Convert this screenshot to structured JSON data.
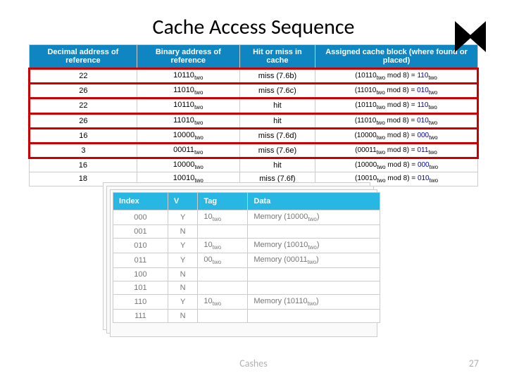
{
  "title": "Cache Access Sequence",
  "footer": {
    "left": "Cashes",
    "right": "27"
  },
  "table1": {
    "headers": [
      "Decimal address of reference",
      "Binary address of reference",
      "Hit or miss in cache",
      "Assigned cache block (where found or placed)"
    ],
    "rows": [
      {
        "dec": "22",
        "bin": "10110",
        "hm": "miss (7.6b)",
        "assign_in": "10110",
        "assign_out": "110",
        "hl": true
      },
      {
        "dec": "26",
        "bin": "11010",
        "hm": "miss (7.6c)",
        "assign_in": "11010",
        "assign_out": "010",
        "hl": true
      },
      {
        "dec": "22",
        "bin": "10110",
        "hm": "hit",
        "assign_in": "10110",
        "assign_out": "110",
        "hl": true
      },
      {
        "dec": "26",
        "bin": "11010",
        "hm": "hit",
        "assign_in": "11010",
        "assign_out": "010",
        "hl": true
      },
      {
        "dec": "16",
        "bin": "10000",
        "hm": "miss (7.6d)",
        "assign_in": "10000",
        "assign_out": "000",
        "hl": true
      },
      {
        "dec": "3",
        "bin": "00011",
        "hm": "miss (7.6e)",
        "assign_in": "00011",
        "assign_out": "011",
        "hl": true
      },
      {
        "dec": "16",
        "bin": "10000",
        "hm": "hit",
        "assign_in": "10000",
        "assign_out": "000",
        "hl": false
      },
      {
        "dec": "18",
        "bin": "10010",
        "hm": "miss (7.6f)",
        "assign_in": "10010",
        "assign_out": "010",
        "hl": false
      }
    ]
  },
  "table2": {
    "headers": [
      "Index",
      "V",
      "Tag",
      "Data"
    ],
    "rows": [
      {
        "idx": "000",
        "v": "Y",
        "tag": "10",
        "data": "Memory (10000",
        "has": true
      },
      {
        "idx": "001",
        "v": "N",
        "tag": "",
        "data": "",
        "has": false
      },
      {
        "idx": "010",
        "v": "Y",
        "tag": "10",
        "data": "Memory (10010",
        "has": true
      },
      {
        "idx": "011",
        "v": "Y",
        "tag": "00",
        "data": "Memory (00011",
        "has": true
      },
      {
        "idx": "100",
        "v": "N",
        "tag": "",
        "data": "",
        "has": false
      },
      {
        "idx": "101",
        "v": "N",
        "tag": "",
        "data": "",
        "has": false
      },
      {
        "idx": "110",
        "v": "Y",
        "tag": "10",
        "data": "Memory (10110",
        "has": true
      },
      {
        "idx": "111",
        "v": "N",
        "tag": "",
        "data": "",
        "has": false
      }
    ]
  }
}
